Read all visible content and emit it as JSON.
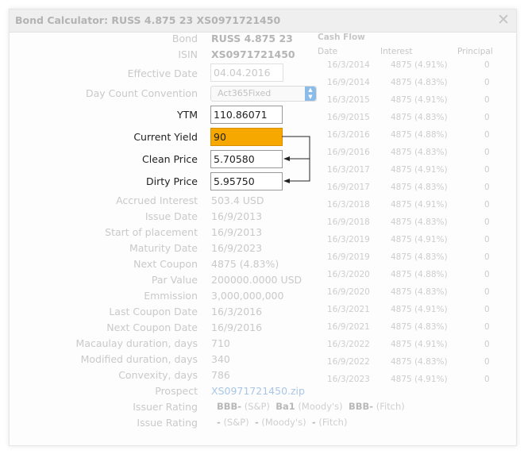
{
  "dialog": {
    "title": "Bond Calculator: RUSS 4.875 23 XS0971721450",
    "close_icon": "close-icon"
  },
  "form": {
    "bond_label": "Bond",
    "bond_value": "RUSS 4.875 23",
    "isin_label": "ISIN",
    "isin_value": "XS0971721450",
    "effective_date_label": "Effective Date",
    "effective_date_value": "04.04.2016",
    "day_count_label": "Day Count Convention",
    "day_count_value": "Act365Fixed",
    "ytm_label": "YTM",
    "ytm_value": "110.86071",
    "current_yield_label": "Current Yield",
    "current_yield_value": "90",
    "clean_price_label": "Clean Price",
    "clean_price_value": "5.70580",
    "dirty_price_label": "Dirty Price",
    "dirty_price_value": "5.95750"
  },
  "info": [
    {
      "label": "Accrued Interest",
      "value": "503.4 USD"
    },
    {
      "label": "Issue Date",
      "value": "16/9/2013"
    },
    {
      "label": "Start of placement",
      "value": "16/9/2013"
    },
    {
      "label": "Maturity Date",
      "value": "16/9/2023"
    },
    {
      "label": "Next Coupon",
      "value": "4875 (4.83%)"
    },
    {
      "label": "Par Value",
      "value": "200000.0000 USD"
    },
    {
      "label": "Emmission",
      "value": "3,000,000,000"
    },
    {
      "label": "Last Coupon Date",
      "value": "16/3/2016"
    },
    {
      "label": "Next Coupon Date",
      "value": "16/9/2016"
    },
    {
      "label": "Macaulay duration, days",
      "value": "710"
    },
    {
      "label": "Modified duration, days",
      "value": "340"
    },
    {
      "label": "Convexity, days",
      "value": "786"
    },
    {
      "label": "Prospect",
      "value": "XS0971721450.zip"
    }
  ],
  "issuer_rating": {
    "label": "Issuer Rating",
    "sp": "BBB-",
    "sp_tag": "(S&P)",
    "moodys": "Ba1",
    "moodys_tag": "(Moody's)",
    "fitch": "BBB-",
    "fitch_tag": "(Fitch)"
  },
  "issue_rating": {
    "label": "Issue Rating",
    "sp": "-",
    "sp_tag": "(S&P)",
    "moodys": "-",
    "moodys_tag": "(Moody's)",
    "fitch": "-",
    "fitch_tag": "(Fitch)"
  },
  "cashflow": {
    "title": "Cash Flow",
    "columns": [
      "Date",
      "Interest",
      "Principal"
    ],
    "rows": [
      [
        "16/3/2014",
        "4875 (4.91%)",
        "0"
      ],
      [
        "16/9/2014",
        "4875 (4.83%)",
        "0"
      ],
      [
        "16/3/2015",
        "4875 (4.91%)",
        "0"
      ],
      [
        "16/9/2015",
        "4875 (4.83%)",
        "0"
      ],
      [
        "16/3/2016",
        "4875 (4.88%)",
        "0"
      ],
      [
        "16/9/2016",
        "4875 (4.83%)",
        "0"
      ],
      [
        "16/3/2017",
        "4875 (4.91%)",
        "0"
      ],
      [
        "16/9/2017",
        "4875 (4.83%)",
        "0"
      ],
      [
        "16/3/2018",
        "4875 (4.91%)",
        "0"
      ],
      [
        "16/9/2018",
        "4875 (4.83%)",
        "0"
      ],
      [
        "16/3/2019",
        "4875 (4.91%)",
        "0"
      ],
      [
        "16/9/2019",
        "4875 (4.83%)",
        "0"
      ],
      [
        "16/3/2020",
        "4875 (4.88%)",
        "0"
      ],
      [
        "16/9/2020",
        "4875 (4.83%)",
        "0"
      ],
      [
        "16/3/2021",
        "4875 (4.91%)",
        "0"
      ],
      [
        "16/9/2021",
        "4875 (4.83%)",
        "0"
      ],
      [
        "16/3/2022",
        "4875 (4.91%)",
        "0"
      ],
      [
        "16/9/2022",
        "4875 (4.83%)",
        "0"
      ],
      [
        "16/3/2023",
        "4875 (4.91%)",
        "0"
      ]
    ]
  },
  "colors": {
    "highlight": "#f7a800",
    "link": "#a9c6e8",
    "muted_text": "#c9c9c9"
  }
}
